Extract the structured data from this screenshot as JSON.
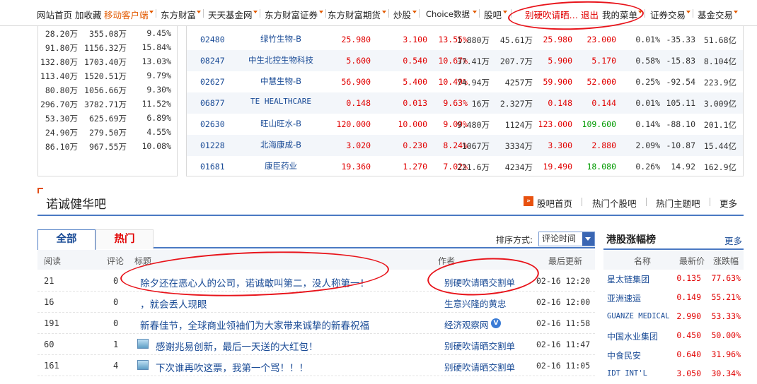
{
  "nav": {
    "items": [
      {
        "label": "网站首页",
        "style": "plain"
      },
      {
        "label": "加收藏",
        "style": "plain"
      },
      {
        "label": "移动客户端",
        "style": "accent"
      },
      {
        "label": "东方财富",
        "style": "plain"
      },
      {
        "label": "天天基金网",
        "style": "plain"
      },
      {
        "label": "东方财富证券",
        "style": "plain"
      },
      {
        "label": "东方财富期货",
        "style": "plain"
      },
      {
        "label": "炒股",
        "style": "plain"
      },
      {
        "label": "Choice数据",
        "style": "plain"
      },
      {
        "label": "股吧",
        "style": "plain"
      },
      {
        "label": "别硬吹请晒…",
        "style": "red"
      },
      {
        "label": "退出",
        "style": "red"
      },
      {
        "label": "我的菜单",
        "style": "plain"
      },
      {
        "label": "证券交易",
        "style": "plain"
      },
      {
        "label": "基金交易",
        "style": "plain"
      }
    ]
  },
  "left_table": {
    "rows": [
      [
        "28.20万",
        "355.08万",
        "9.45%"
      ],
      [
        "91.80万",
        "1156.32万",
        "15.84%"
      ],
      [
        "132.80万",
        "1703.40万",
        "13.03%"
      ],
      [
        "113.40万",
        "1520.51万",
        "9.79%"
      ],
      [
        "80.80万",
        "1056.66万",
        "9.30%"
      ],
      [
        "296.70万",
        "3782.71万",
        "11.52%"
      ],
      [
        "53.30万",
        "625.69万",
        "6.89%"
      ],
      [
        "24.90万",
        "279.50万",
        "4.55%"
      ],
      [
        "86.10万",
        "967.55万",
        "10.08%"
      ]
    ]
  },
  "stock_table": {
    "rows": [
      {
        "code": "02480",
        "name": "绿竹生物-B",
        "price": "25.980",
        "chg": "3.100",
        "pct": "13.55%",
        "vol": "1.880万",
        "amt": "45.61万",
        "high": "25.980",
        "low": "23.000",
        "low_dir": "up",
        "turnover": "0.01%",
        "pe": "-35.33",
        "cap": "51.68亿"
      },
      {
        "code": "08247",
        "name": "中生北控生物科技",
        "price": "5.600",
        "chg": "0.540",
        "pct": "10.67%",
        "vol": "37.41万",
        "amt": "207.7万",
        "high": "5.900",
        "low": "5.170",
        "low_dir": "up",
        "turnover": "0.58%",
        "pe": "-15.83",
        "cap": "8.104亿"
      },
      {
        "code": "02627",
        "name": "中慧生物-B",
        "price": "56.900",
        "chg": "5.400",
        "pct": "10.49%",
        "vol": "74.94万",
        "amt": "4257万",
        "high": "59.900",
        "low": "52.000",
        "low_dir": "up",
        "turnover": "0.25%",
        "pe": "-92.54",
        "cap": "223.9亿"
      },
      {
        "code": "06877",
        "name": "TE HEALTHCARE",
        "price": "0.148",
        "chg": "0.013",
        "pct": "9.63%",
        "vol": "16万",
        "amt": "2.327万",
        "high": "0.148",
        "low": "0.144",
        "low_dir": "up",
        "turnover": "0.01%",
        "pe": "105.11",
        "cap": "3.009亿"
      },
      {
        "code": "02630",
        "name": "旺山旺水-B",
        "price": "120.000",
        "chg": "10.000",
        "pct": "9.09%",
        "vol": "9.480万",
        "amt": "1124万",
        "high": "123.000",
        "low": "109.600",
        "low_dir": "down",
        "turnover": "0.14%",
        "pe": "-88.10",
        "cap": "201.1亿"
      },
      {
        "code": "01228",
        "name": "北海康成-B",
        "price": "3.020",
        "chg": "0.230",
        "pct": "8.24%",
        "vol": "1067万",
        "amt": "3334万",
        "high": "3.300",
        "low": "2.880",
        "low_dir": "up",
        "turnover": "2.09%",
        "pe": "-10.87",
        "cap": "15.44亿"
      },
      {
        "code": "01681",
        "name": "康臣药业",
        "price": "19.360",
        "chg": "1.270",
        "pct": "7.02%",
        "vol": "221.6万",
        "amt": "4234万",
        "high": "19.490",
        "low": "18.080",
        "low_dir": "down",
        "turnover": "0.26%",
        "pe": "14.92",
        "cap": "162.9亿"
      }
    ]
  },
  "bar": {
    "title": "诺诚健华吧",
    "home_link": "股吧首页",
    "hot_bars": "热门个股吧",
    "hot_topics": "热门主题吧",
    "more": "更多"
  },
  "posts": {
    "tab_all": "全部",
    "tab_hot": "热门",
    "sort_label": "排序方式:",
    "sort_value": "评论时间",
    "headers": {
      "reads": "阅读",
      "comments": "评论",
      "title": "标题",
      "author": "作者",
      "updated": "最后更新"
    },
    "rows": [
      {
        "reads": "21",
        "comments": "0",
        "title": "除夕还在恶心人的公司，诺诚敢叫第二，没人称第一！",
        "author": "别硬吹请晒交割单",
        "updated": "02-16 12:20",
        "icon": "",
        "verified": false
      },
      {
        "reads": "16",
        "comments": "0",
        "title": "，就会丢人现眼",
        "author": "生意兴隆的黄忠",
        "updated": "02-16 12:00",
        "icon": "",
        "verified": false
      },
      {
        "reads": "191",
        "comments": "0",
        "title": "新春佳节，全球商业领袖们为大家带来诚挚的新春祝福",
        "author": "经济观察网",
        "updated": "02-16 11:58",
        "icon": "",
        "verified": true
      },
      {
        "reads": "60",
        "comments": "1",
        "title": "感谢兆易创新，最后一天送的大红包！",
        "author": "别硬吹请晒交割单",
        "updated": "02-16 11:47",
        "icon": "image-icon",
        "verified": false
      },
      {
        "reads": "161",
        "comments": "4",
        "title": "下次谁再吹这票，我第一个骂！！！",
        "author": "别硬吹请晒交割单",
        "updated": "02-16 11:05",
        "icon": "image-icon",
        "verified": false
      }
    ]
  },
  "hk_rank": {
    "title": "港股涨幅榜",
    "more": "更多",
    "headers": {
      "name": "名称",
      "price": "最新价",
      "pct": "涨跌幅"
    },
    "rows": [
      {
        "name": "星太链集团",
        "price": "0.135",
        "pct": "77.63%"
      },
      {
        "name": "亚洲速运",
        "price": "0.149",
        "pct": "55.21%"
      },
      {
        "name": "GUANZE MEDICAL",
        "price": "2.990",
        "pct": "53.33%"
      },
      {
        "name": "中国水业集团",
        "price": "0.450",
        "pct": "50.00%"
      },
      {
        "name": "中食民安",
        "price": "0.640",
        "pct": "31.96%"
      },
      {
        "name": "IDT INT'L",
        "price": "3.050",
        "pct": "30.34%"
      }
    ]
  },
  "colors": {
    "up": "#e10000",
    "down": "#009a00",
    "link": "#1a4b96",
    "accent": "#e35a00",
    "annotation": "#e8141b"
  }
}
